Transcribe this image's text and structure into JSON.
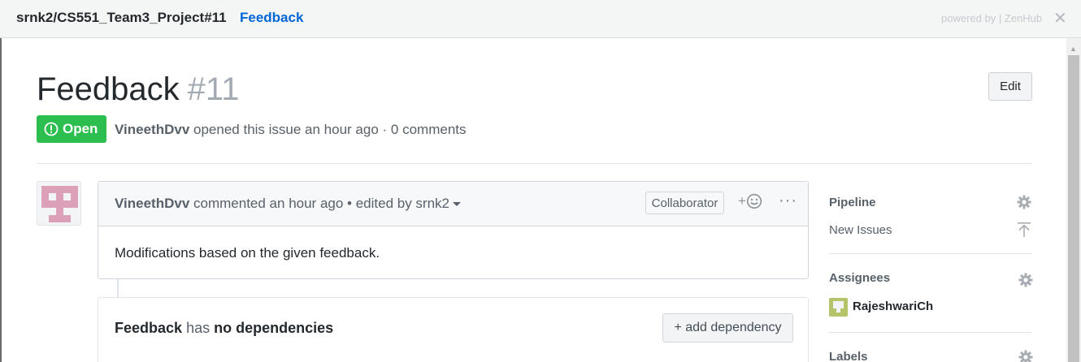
{
  "header": {
    "repo": "srnk2/CS551_Team3_Project#11",
    "issue_link": "Feedback",
    "powered_by": "powered by | ZenHub",
    "close_glyph": "✕"
  },
  "issue": {
    "title": "Feedback",
    "number": "#11",
    "edit_label": "Edit",
    "status": "Open",
    "status_color": "#2cbe4e",
    "author": "VineethDvv",
    "meta_suffix": "opened this issue an hour ago · 0 comments"
  },
  "comment": {
    "author": "VineethDvv",
    "meta": "commented an hour ago • edited by srnk2",
    "badge": "Collaborator",
    "reaction_label": "+",
    "more_label": "···",
    "body": "Modifications based on the given feedback."
  },
  "dependencies": {
    "issue": "Feedback",
    "has": "has",
    "none": "no dependencies",
    "add_label": "+ add dependency"
  },
  "sidebar": {
    "pipeline_label": "Pipeline",
    "pipeline_value": "New Issues",
    "assignees_label": "Assignees",
    "assignee": "RajeshwariCh",
    "labels_label": "Labels"
  },
  "colors": {
    "link": "#0366d6",
    "avatar_pink": "#dda0b9",
    "assignee_green": "#b5c46a"
  },
  "icons": {
    "gear": "gear-icon",
    "move_top": "move-to-top-icon",
    "smiley": "smiley-icon",
    "issue_opened": "issue-opened-icon"
  }
}
